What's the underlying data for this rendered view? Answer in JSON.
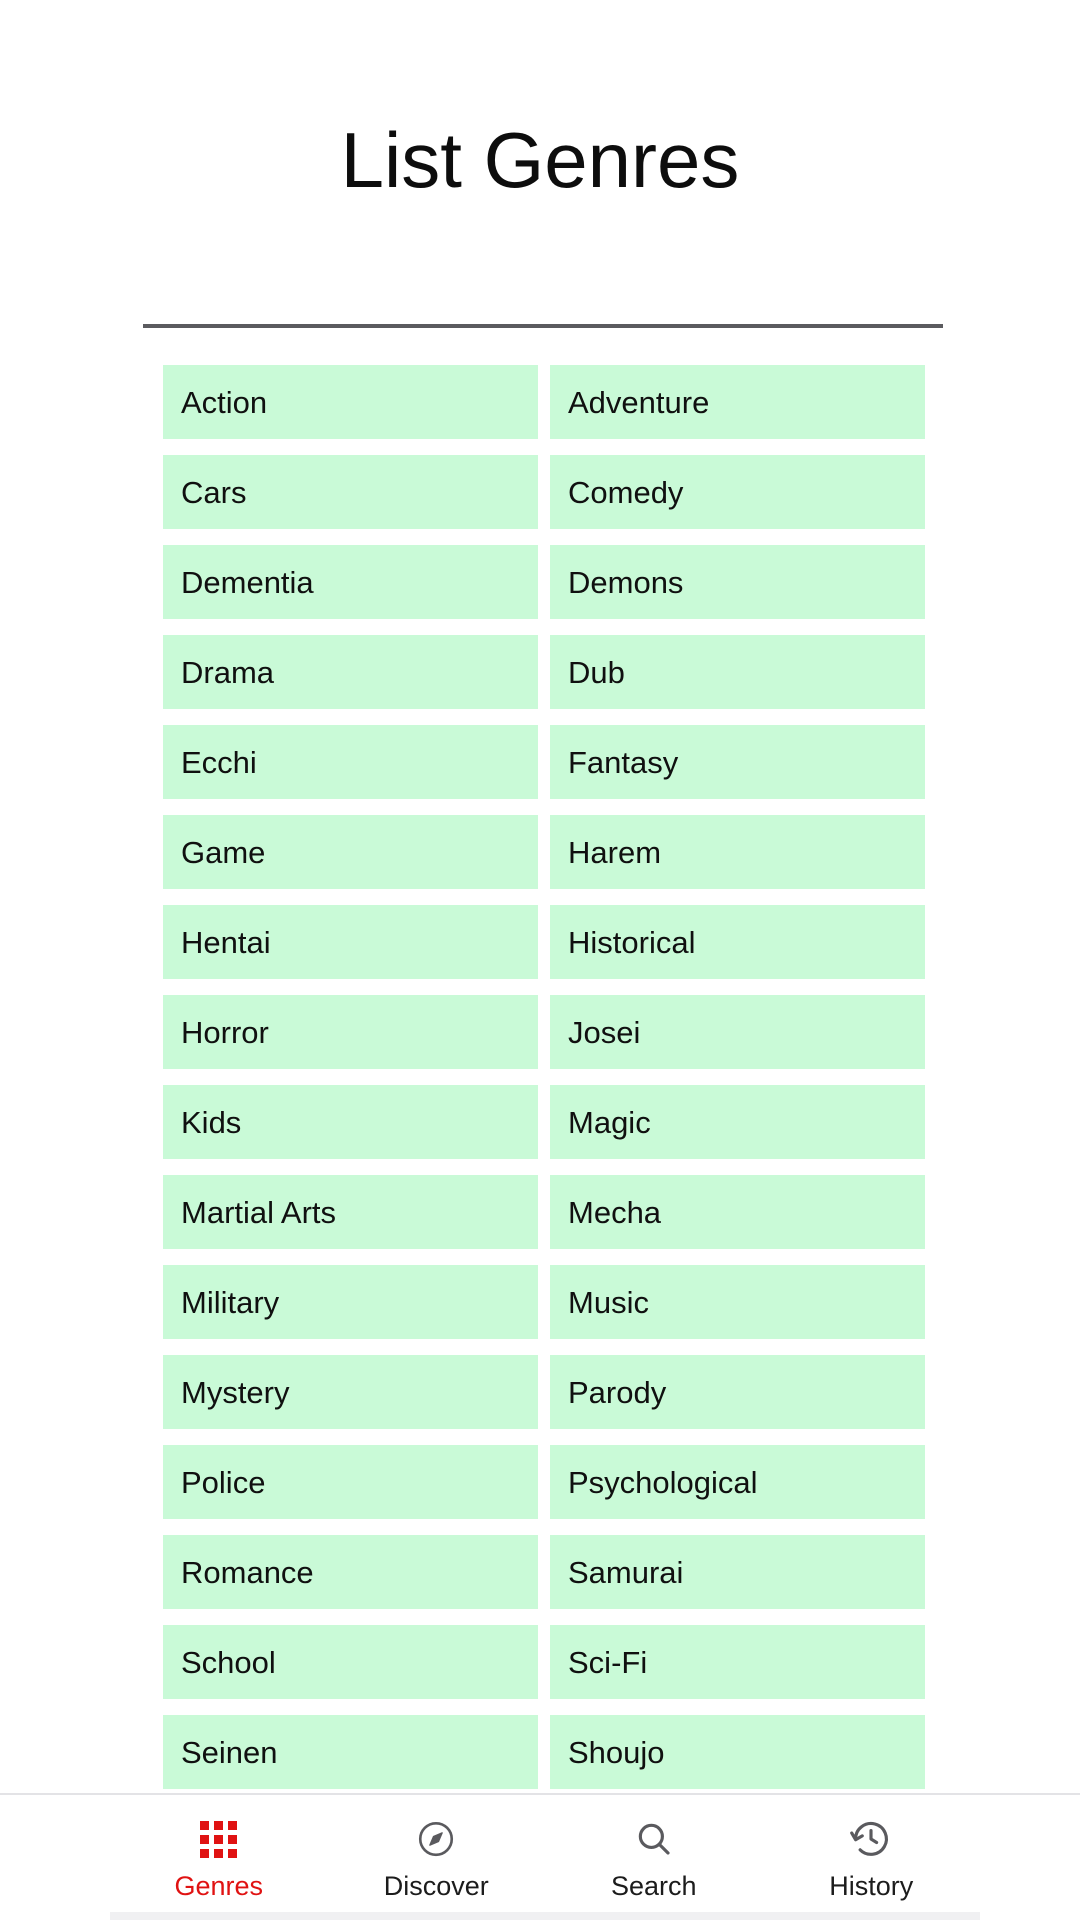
{
  "header": {
    "title": "List Genres"
  },
  "genres": [
    "Action",
    "Adventure",
    "Cars",
    "Comedy",
    "Dementia",
    "Demons",
    "Drama",
    "Dub",
    "Ecchi",
    "Fantasy",
    "Game",
    "Harem",
    "Hentai",
    "Historical",
    "Horror",
    "Josei",
    "Kids",
    "Magic",
    "Martial Arts",
    "Mecha",
    "Military",
    "Music",
    "Mystery",
    "Parody",
    "Police",
    "Psychological",
    "Romance",
    "Samurai",
    "School",
    "Sci-Fi",
    "Seinen",
    "Shoujo"
  ],
  "bottom_nav": {
    "items": [
      {
        "label": "Genres",
        "icon": "grid-icon",
        "active": true
      },
      {
        "label": "Discover",
        "icon": "compass-icon",
        "active": false
      },
      {
        "label": "Search",
        "icon": "search-icon",
        "active": false
      },
      {
        "label": "History",
        "icon": "history-icon",
        "active": false
      }
    ]
  },
  "colors": {
    "chip_background": "#C9FAD7",
    "chip_text": "#101010",
    "accent_active": "#E01212",
    "divider": "#5B5B5F",
    "nav_inactive": "#5A5A5E",
    "page_background": "#FFFFFF"
  }
}
